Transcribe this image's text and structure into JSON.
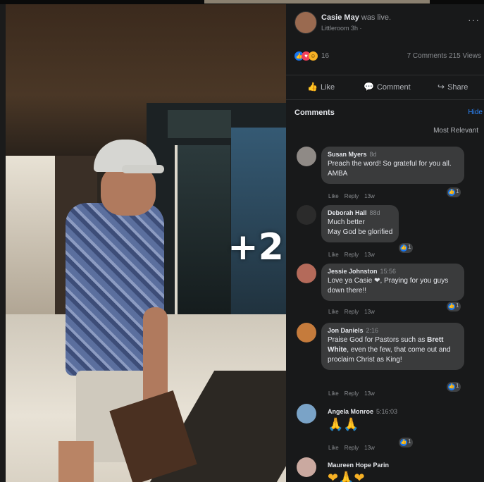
{
  "post": {
    "author": "Casie May",
    "live_text": "was live.",
    "subtitle": "Littleroom 3h ·",
    "more": "···",
    "reaction_count": "16",
    "stats": "7 Comments  215 Views",
    "actions": {
      "like": "Like",
      "comment": "Comment",
      "share": "Share"
    }
  },
  "overlay": {
    "more_photos": "+2"
  },
  "comments_header": {
    "title": "Comments",
    "hide": "Hide",
    "sort": "Most Relevant"
  },
  "comments": [
    {
      "author": "Susan Myers",
      "time": "8d",
      "text": "Preach the word! So grateful for you all. AMBA",
      "like": "Like",
      "reply": "Reply",
      "age": "13w",
      "reactions": "1"
    },
    {
      "author": "Deborah Hall",
      "time": "88d",
      "text": "Much better\nMay God be glorified",
      "like": "Like",
      "reply": "Reply",
      "age": "13w",
      "reactions": "1"
    },
    {
      "author": "Jessie Johnston",
      "time": "15:56",
      "text": "Love ya Casie ❤, Praying for you guys down there!!",
      "like": "Like",
      "reply": "Reply",
      "age": "13w",
      "reactions": "1"
    },
    {
      "author": "Jon Daniels",
      "time": "2:16",
      "text_before": "Praise God for Pastors such as ",
      "text_bold": "Brett White",
      "text_after": ", even the few, that come out and proclaim Christ as King!",
      "like": "Like",
      "reply": "Reply",
      "age": "13w",
      "reactions": "1"
    },
    {
      "author": "Angela Monroe",
      "time": "5:16:03",
      "text": "🙏🙏",
      "like": "Like",
      "reply": "Reply",
      "age": "13w",
      "reactions": "1"
    },
    {
      "author": "Maureen Hope Parin",
      "time": "",
      "text": "❤🙏❤"
    }
  ],
  "colors": {
    "panel_bg": "#18191a",
    "bubble_bg": "#3a3b3c",
    "link": "#2d88ff",
    "like_blue": "#1877f2",
    "love_red": "#f33e58",
    "haha_yellow": "#f7b125"
  }
}
